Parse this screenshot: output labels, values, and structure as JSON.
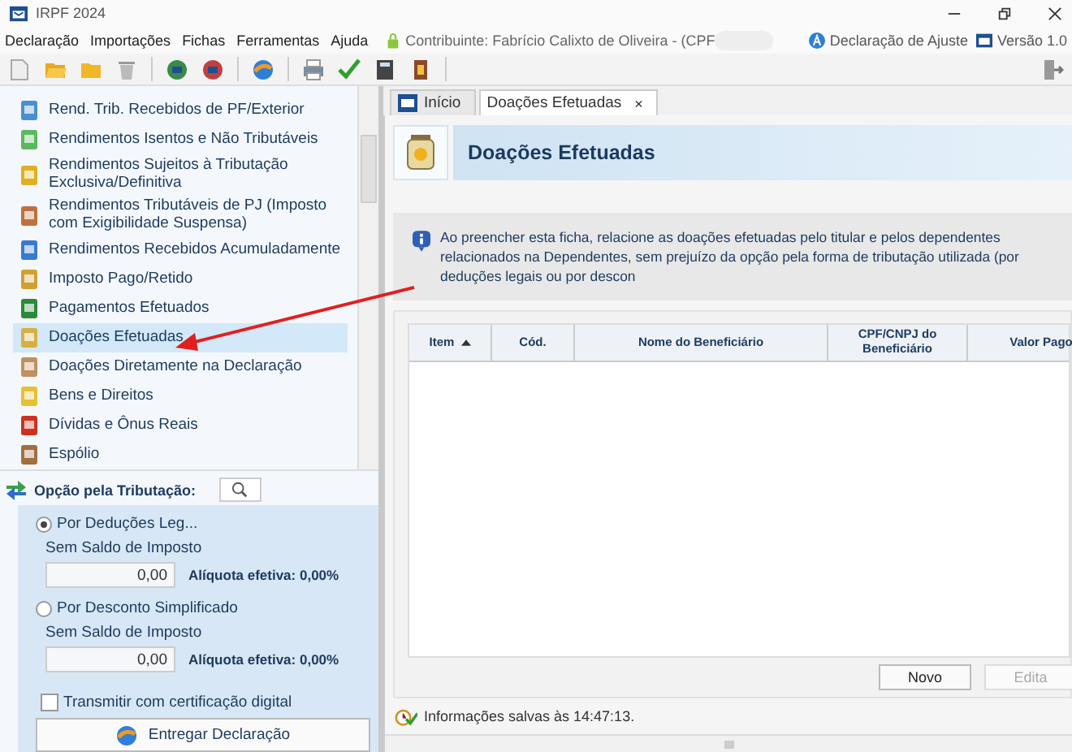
{
  "window": {
    "title": "IRPF 2024"
  },
  "menu": [
    "Declaração",
    "Importações",
    "Fichas",
    "Ferramentas",
    "Ajuda"
  ],
  "contributor": "Contribuinte: Fabrício Calixto de Oliveira - (CPF",
  "declaration_type": "Declaração de Ajuste",
  "version": "Versão 1.0",
  "sidebar": {
    "items": [
      {
        "label": "Rend. Trib. Recebidos de PF/Exterior",
        "selected": false
      },
      {
        "label": "Rendimentos Isentos e Não Tributáveis",
        "selected": false
      },
      {
        "label": "Rendimentos Sujeitos à Tributação Exclusiva/Definitiva",
        "selected": false
      },
      {
        "label": "Rendimentos Tributáveis de PJ (Imposto com Exigibilidade Suspensa)",
        "selected": false
      },
      {
        "label": "Rendimentos Recebidos Acumuladamente",
        "selected": false
      },
      {
        "label": "Imposto Pago/Retido",
        "selected": false
      },
      {
        "label": "Pagamentos Efetuados",
        "selected": false
      },
      {
        "label": "Doações Efetuadas",
        "selected": true
      },
      {
        "label": "Doações Diretamente na Declaração",
        "selected": false
      },
      {
        "label": "Bens e Direitos",
        "selected": false
      },
      {
        "label": "Dívidas e Ônus Reais",
        "selected": false
      },
      {
        "label": "Espólio",
        "selected": false
      }
    ]
  },
  "tax_option": {
    "title": "Opção pela Tributação:",
    "options": [
      {
        "label": "Por Deduções Leg...",
        "selected": true,
        "caption": "Sem Saldo de Imposto",
        "value": "0,00",
        "rate": "Alíquota efetiva: 0,00%"
      },
      {
        "label": "Por Desconto Simplificado",
        "selected": false,
        "caption": "Sem Saldo de Imposto",
        "value": "0,00",
        "rate": "Alíquota efetiva: 0,00%"
      }
    ],
    "certificate": {
      "label": "Transmitir com certificação digital",
      "checked": false
    },
    "submit": "Entregar Declaração"
  },
  "tabs": [
    {
      "label": "Início",
      "selected": false
    },
    {
      "label": "Doações Efetuadas",
      "selected": true,
      "close": "×"
    }
  ],
  "panel": {
    "title": "Doações Efetuadas",
    "info": "Ao preencher esta ficha, relacione as doações efetuadas pelo titular e pelos dependentes relacionados na Dependentes, sem prejuízo da opção pela forma de tributação utilizada (por deduções legais ou por descon",
    "table": {
      "columns": [
        {
          "label": "Item",
          "sorted": true
        },
        {
          "label": "Cód.",
          "sorted": false
        },
        {
          "label": "Nome do Beneficiário",
          "sorted": false
        },
        {
          "label": "CPF/CNPJ do Beneficiário",
          "sorted": false
        },
        {
          "label": "Valor Pago",
          "sorted": false
        }
      ]
    },
    "buttons": [
      {
        "label": "Novo",
        "disabled": false
      },
      {
        "label": "Edita",
        "disabled": true
      }
    ]
  },
  "status": "Informações salvas às 14:47:13."
}
